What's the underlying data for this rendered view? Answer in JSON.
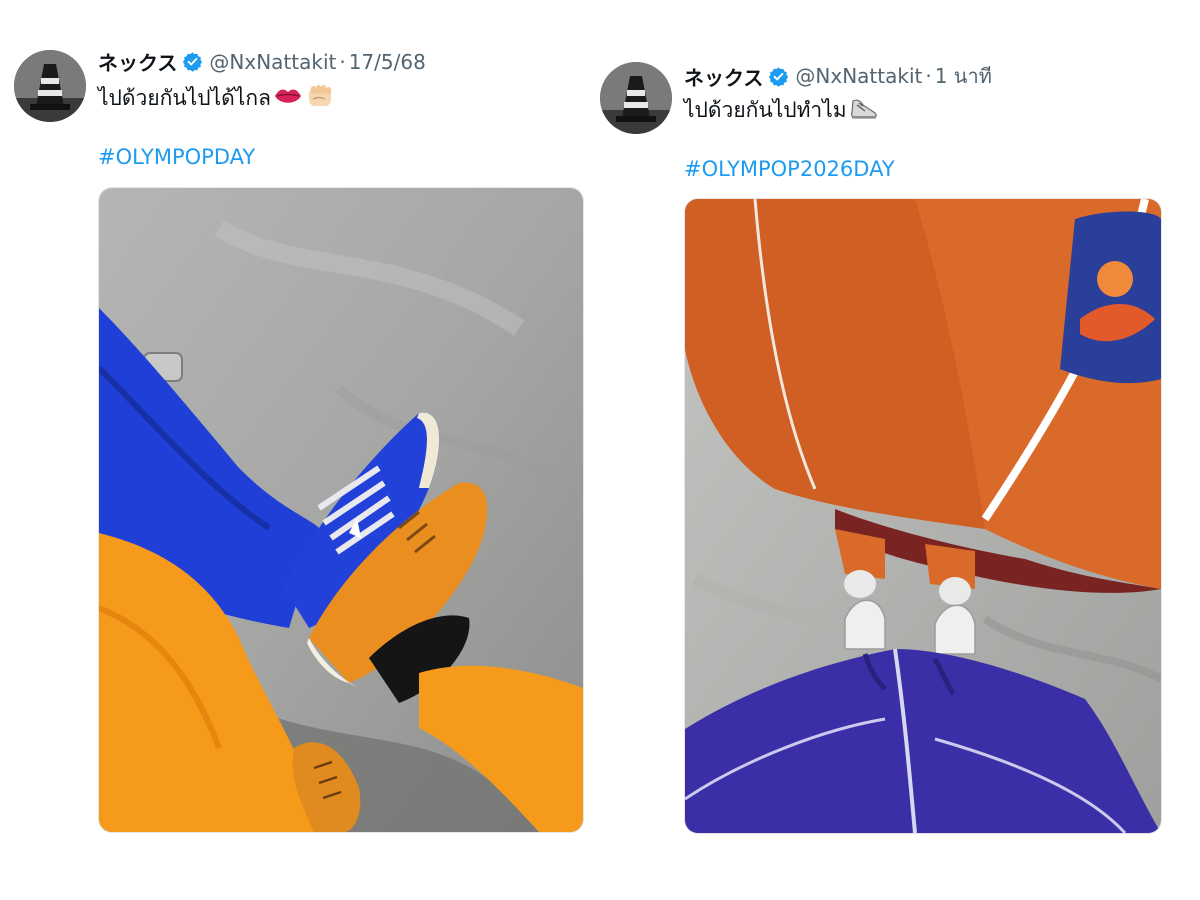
{
  "tweets": [
    {
      "display_name": "ネックス",
      "verified_icon": "verified-badge-icon",
      "handle": "@NxNattakit",
      "separator": "·",
      "timestamp": "17/5/68",
      "text": "ไปด้วยกันไปได้ไกล",
      "emojis": [
        "lips-emoji",
        "fist-bump-emoji"
      ],
      "hashtag": "#OLYMPOPDAY",
      "media_description_icon": "photo-blue-and-orange-sneakers"
    },
    {
      "display_name": "ネックス",
      "verified_icon": "verified-badge-icon",
      "handle": "@NxNattakit",
      "separator": "·",
      "timestamp": "1 นาที",
      "text": "ไปด้วยกันไปทำไม",
      "emojis": [
        "sneaker-emoji"
      ],
      "hashtag": "#OLYMPOP2026DAY",
      "media_description_icon": "photo-orange-and-purple-shorts"
    }
  ],
  "colors": {
    "accent_link": "#1d9bf0",
    "verified": "#1d9bf0",
    "meta_gray": "#536471",
    "text": "#0f1419"
  }
}
